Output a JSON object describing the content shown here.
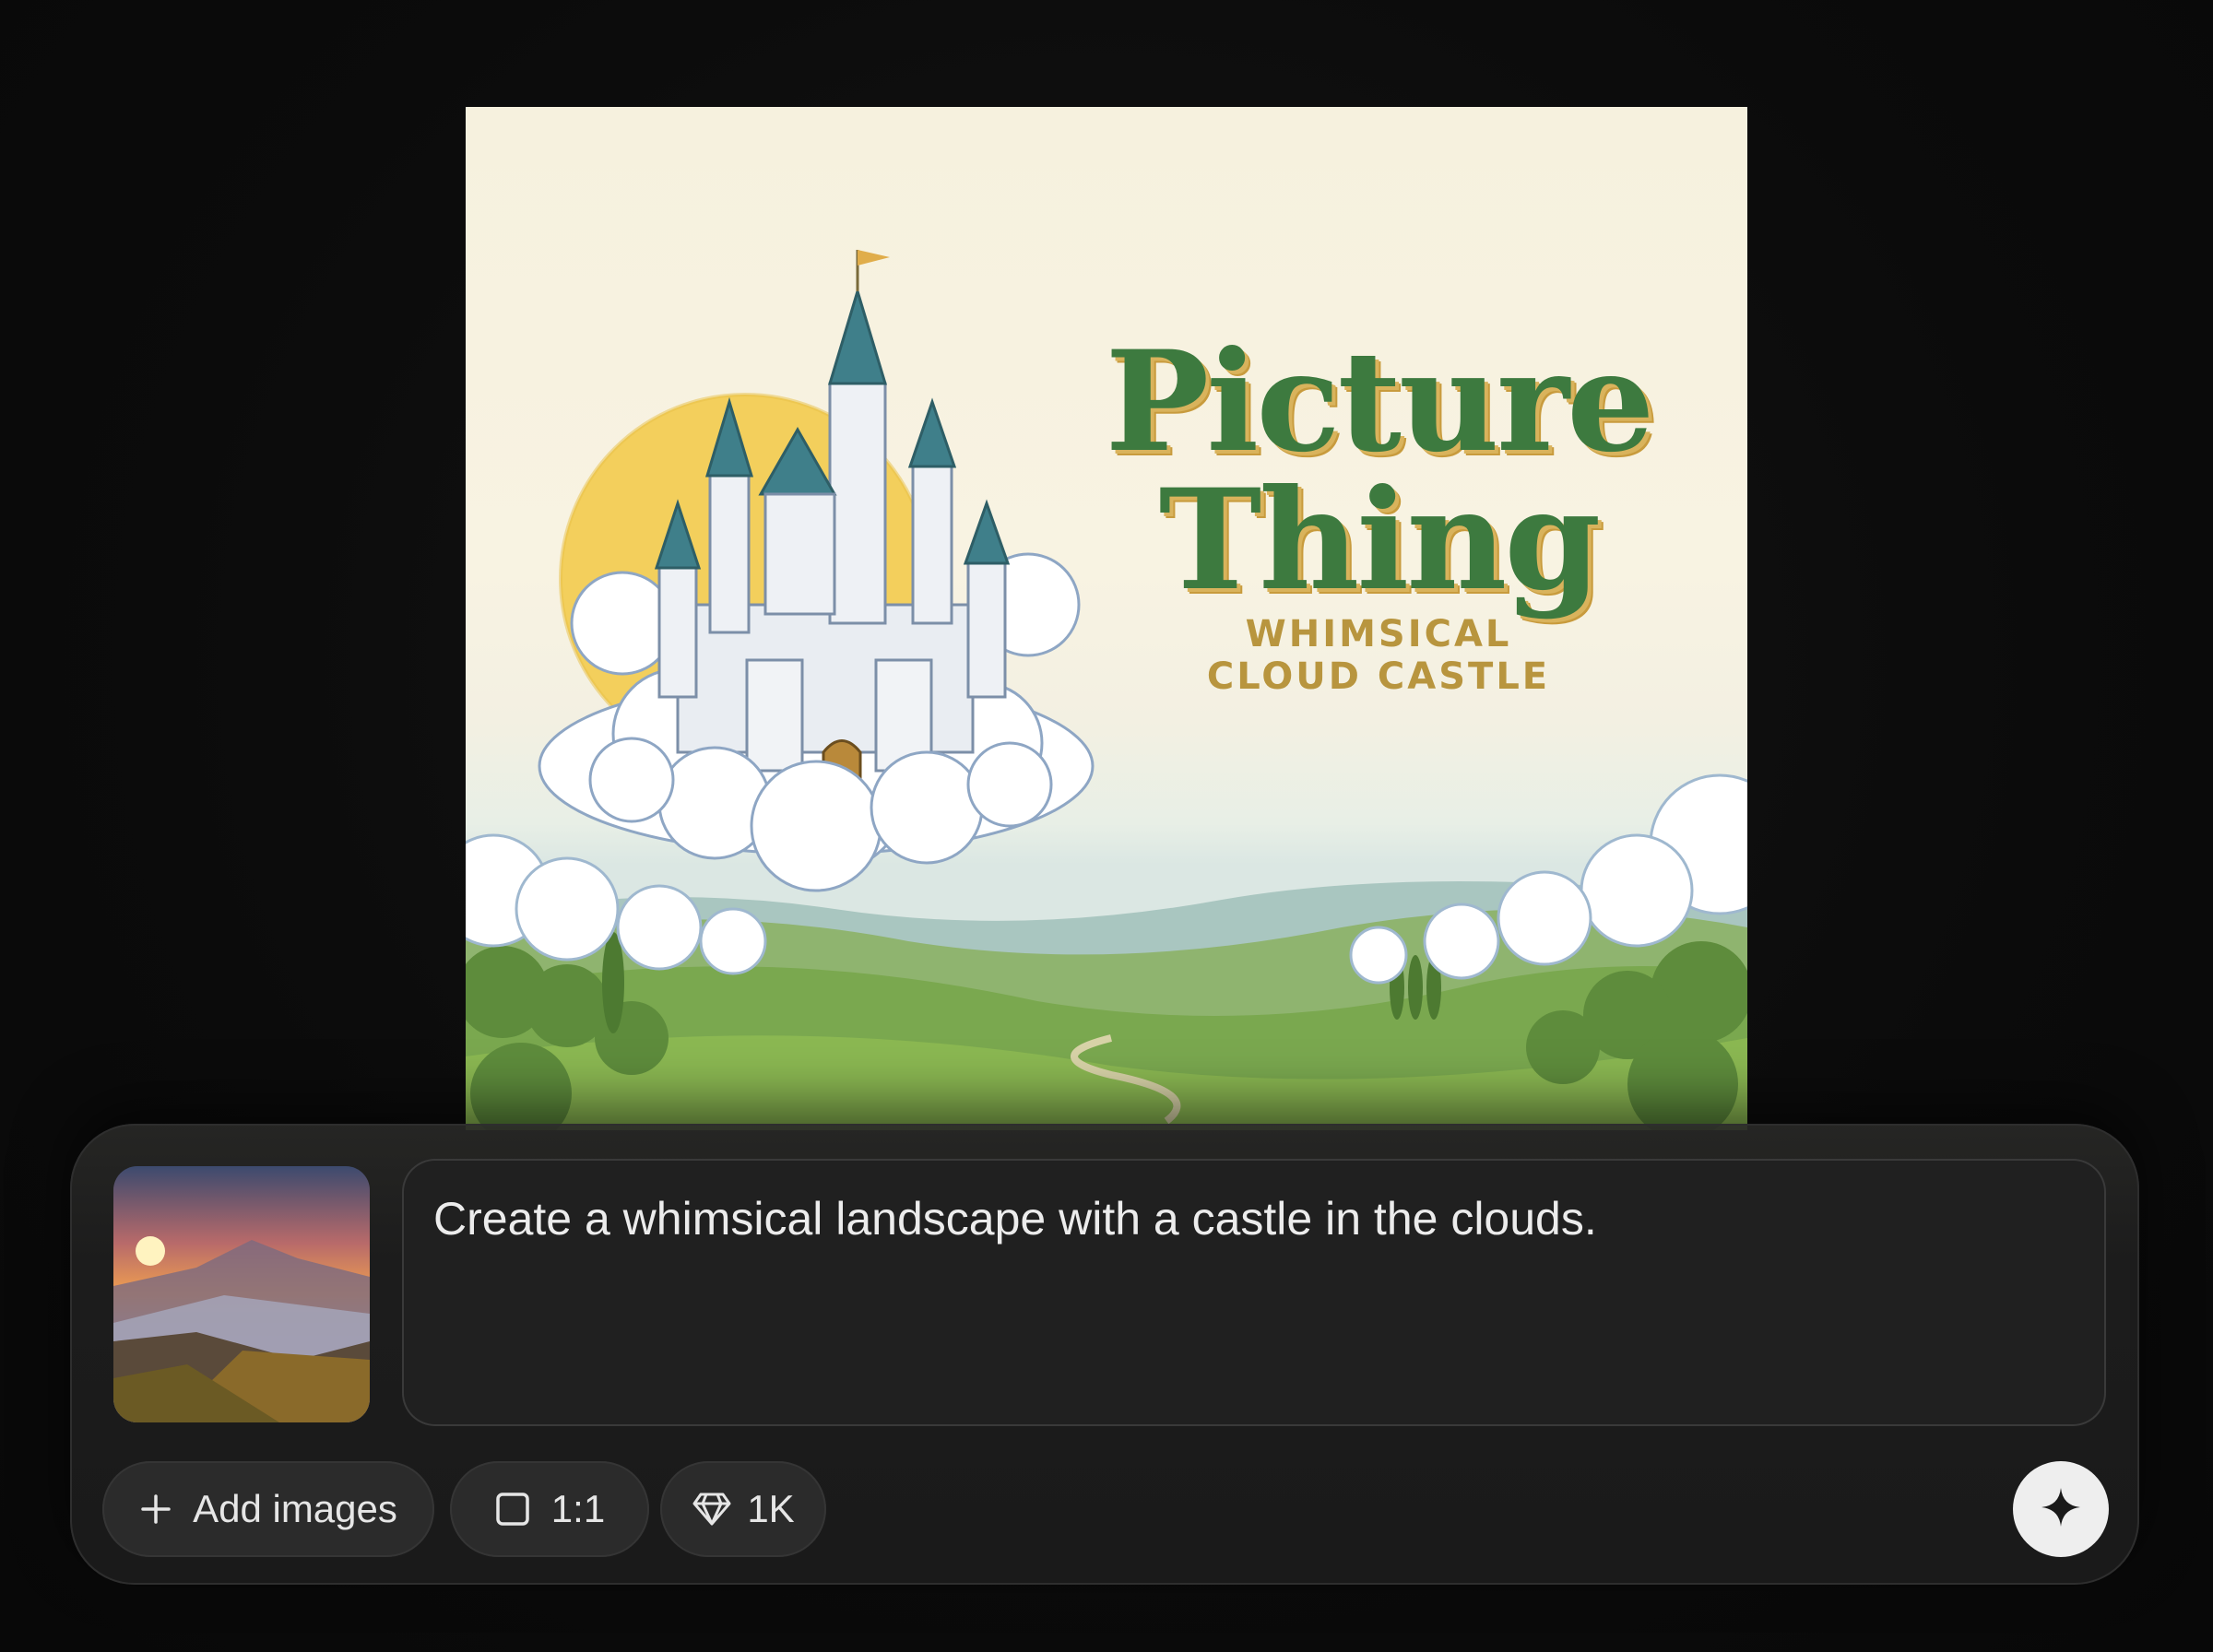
{
  "artwork": {
    "title_line1": "Picture",
    "title_line2": "Thing",
    "subtitle_line1": "WHIMSICAL",
    "subtitle_line2": "CLOUD CASTLE"
  },
  "composer": {
    "prompt_value": "Create a whimsical landscape with a castle in the clouds.",
    "attachment_icon": "sunset-mountain-thumbnail",
    "toolbar": {
      "add_images_label": "Add images",
      "add_images_icon": "plus-icon",
      "aspect_ratio_label": "1:1",
      "aspect_ratio_icon": "square-icon",
      "quality_label": "1K",
      "quality_icon": "diamond-icon"
    },
    "send_icon": "sparkle-icon"
  },
  "colors": {
    "background": "#0b0b0b",
    "panel": "#1c1c1c",
    "title_green": "#3d7a3f",
    "subtitle_gold": "#b8953e",
    "sun_yellow": "#f3cf5c",
    "send_button": "#eeeeee"
  }
}
